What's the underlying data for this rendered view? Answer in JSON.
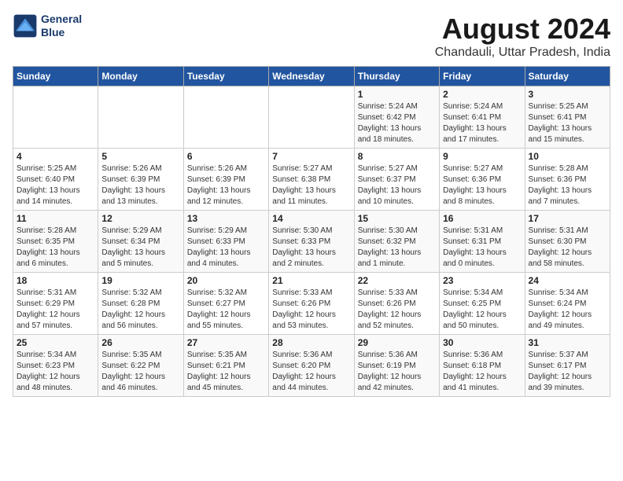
{
  "header": {
    "logo_line1": "General",
    "logo_line2": "Blue",
    "title": "August 2024",
    "subtitle": "Chandauli, Uttar Pradesh, India"
  },
  "weekdays": [
    "Sunday",
    "Monday",
    "Tuesday",
    "Wednesday",
    "Thursday",
    "Friday",
    "Saturday"
  ],
  "weeks": [
    [
      {
        "day": "",
        "info": ""
      },
      {
        "day": "",
        "info": ""
      },
      {
        "day": "",
        "info": ""
      },
      {
        "day": "",
        "info": ""
      },
      {
        "day": "1",
        "info": "Sunrise: 5:24 AM\nSunset: 6:42 PM\nDaylight: 13 hours\nand 18 minutes."
      },
      {
        "day": "2",
        "info": "Sunrise: 5:24 AM\nSunset: 6:41 PM\nDaylight: 13 hours\nand 17 minutes."
      },
      {
        "day": "3",
        "info": "Sunrise: 5:25 AM\nSunset: 6:41 PM\nDaylight: 13 hours\nand 15 minutes."
      }
    ],
    [
      {
        "day": "4",
        "info": "Sunrise: 5:25 AM\nSunset: 6:40 PM\nDaylight: 13 hours\nand 14 minutes."
      },
      {
        "day": "5",
        "info": "Sunrise: 5:26 AM\nSunset: 6:39 PM\nDaylight: 13 hours\nand 13 minutes."
      },
      {
        "day": "6",
        "info": "Sunrise: 5:26 AM\nSunset: 6:39 PM\nDaylight: 13 hours\nand 12 minutes."
      },
      {
        "day": "7",
        "info": "Sunrise: 5:27 AM\nSunset: 6:38 PM\nDaylight: 13 hours\nand 11 minutes."
      },
      {
        "day": "8",
        "info": "Sunrise: 5:27 AM\nSunset: 6:37 PM\nDaylight: 13 hours\nand 10 minutes."
      },
      {
        "day": "9",
        "info": "Sunrise: 5:27 AM\nSunset: 6:36 PM\nDaylight: 13 hours\nand 8 minutes."
      },
      {
        "day": "10",
        "info": "Sunrise: 5:28 AM\nSunset: 6:36 PM\nDaylight: 13 hours\nand 7 minutes."
      }
    ],
    [
      {
        "day": "11",
        "info": "Sunrise: 5:28 AM\nSunset: 6:35 PM\nDaylight: 13 hours\nand 6 minutes."
      },
      {
        "day": "12",
        "info": "Sunrise: 5:29 AM\nSunset: 6:34 PM\nDaylight: 13 hours\nand 5 minutes."
      },
      {
        "day": "13",
        "info": "Sunrise: 5:29 AM\nSunset: 6:33 PM\nDaylight: 13 hours\nand 4 minutes."
      },
      {
        "day": "14",
        "info": "Sunrise: 5:30 AM\nSunset: 6:33 PM\nDaylight: 13 hours\nand 2 minutes."
      },
      {
        "day": "15",
        "info": "Sunrise: 5:30 AM\nSunset: 6:32 PM\nDaylight: 13 hours\nand 1 minute."
      },
      {
        "day": "16",
        "info": "Sunrise: 5:31 AM\nSunset: 6:31 PM\nDaylight: 13 hours\nand 0 minutes."
      },
      {
        "day": "17",
        "info": "Sunrise: 5:31 AM\nSunset: 6:30 PM\nDaylight: 12 hours\nand 58 minutes."
      }
    ],
    [
      {
        "day": "18",
        "info": "Sunrise: 5:31 AM\nSunset: 6:29 PM\nDaylight: 12 hours\nand 57 minutes."
      },
      {
        "day": "19",
        "info": "Sunrise: 5:32 AM\nSunset: 6:28 PM\nDaylight: 12 hours\nand 56 minutes."
      },
      {
        "day": "20",
        "info": "Sunrise: 5:32 AM\nSunset: 6:27 PM\nDaylight: 12 hours\nand 55 minutes."
      },
      {
        "day": "21",
        "info": "Sunrise: 5:33 AM\nSunset: 6:26 PM\nDaylight: 12 hours\nand 53 minutes."
      },
      {
        "day": "22",
        "info": "Sunrise: 5:33 AM\nSunset: 6:26 PM\nDaylight: 12 hours\nand 52 minutes."
      },
      {
        "day": "23",
        "info": "Sunrise: 5:34 AM\nSunset: 6:25 PM\nDaylight: 12 hours\nand 50 minutes."
      },
      {
        "day": "24",
        "info": "Sunrise: 5:34 AM\nSunset: 6:24 PM\nDaylight: 12 hours\nand 49 minutes."
      }
    ],
    [
      {
        "day": "25",
        "info": "Sunrise: 5:34 AM\nSunset: 6:23 PM\nDaylight: 12 hours\nand 48 minutes."
      },
      {
        "day": "26",
        "info": "Sunrise: 5:35 AM\nSunset: 6:22 PM\nDaylight: 12 hours\nand 46 minutes."
      },
      {
        "day": "27",
        "info": "Sunrise: 5:35 AM\nSunset: 6:21 PM\nDaylight: 12 hours\nand 45 minutes."
      },
      {
        "day": "28",
        "info": "Sunrise: 5:36 AM\nSunset: 6:20 PM\nDaylight: 12 hours\nand 44 minutes."
      },
      {
        "day": "29",
        "info": "Sunrise: 5:36 AM\nSunset: 6:19 PM\nDaylight: 12 hours\nand 42 minutes."
      },
      {
        "day": "30",
        "info": "Sunrise: 5:36 AM\nSunset: 6:18 PM\nDaylight: 12 hours\nand 41 minutes."
      },
      {
        "day": "31",
        "info": "Sunrise: 5:37 AM\nSunset: 6:17 PM\nDaylight: 12 hours\nand 39 minutes."
      }
    ]
  ]
}
